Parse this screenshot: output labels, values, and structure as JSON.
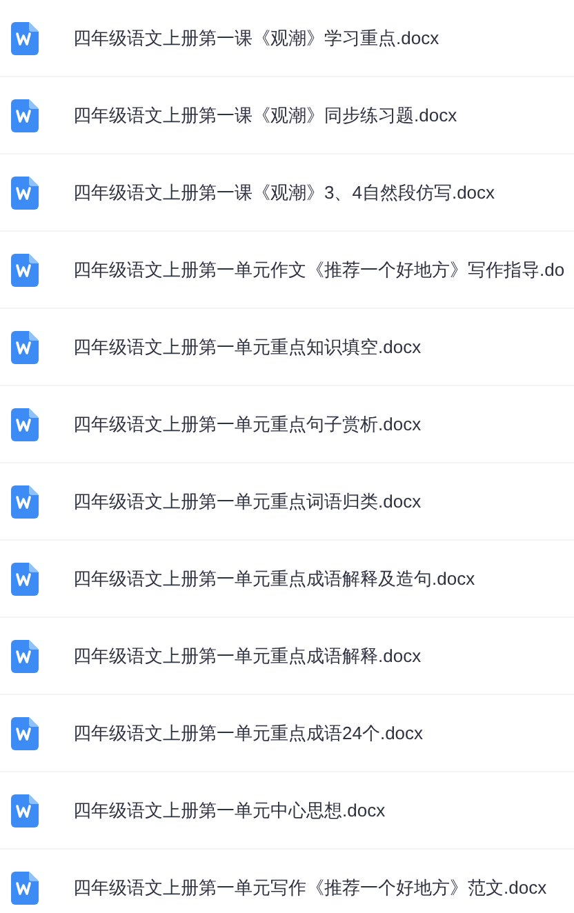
{
  "files": [
    {
      "name": "四年级语文上册第一课《观潮》学习重点.docx"
    },
    {
      "name": "四年级语文上册第一课《观潮》同步练习题.docx"
    },
    {
      "name": "四年级语文上册第一课《观潮》3、4自然段仿写.docx"
    },
    {
      "name": "四年级语文上册第一单元作文《推荐一个好地方》写作指导.do"
    },
    {
      "name": "四年级语文上册第一单元重点知识填空.docx"
    },
    {
      "name": "四年级语文上册第一单元重点句子赏析.docx"
    },
    {
      "name": "四年级语文上册第一单元重点词语归类.docx"
    },
    {
      "name": "四年级语文上册第一单元重点成语解释及造句.docx"
    },
    {
      "name": "四年级语文上册第一单元重点成语解释.docx"
    },
    {
      "name": "四年级语文上册第一单元重点成语24个.docx"
    },
    {
      "name": "四年级语文上册第一单元中心思想.docx"
    },
    {
      "name": "四年级语文上册第一单元写作《推荐一个好地方》范文.docx"
    }
  ]
}
